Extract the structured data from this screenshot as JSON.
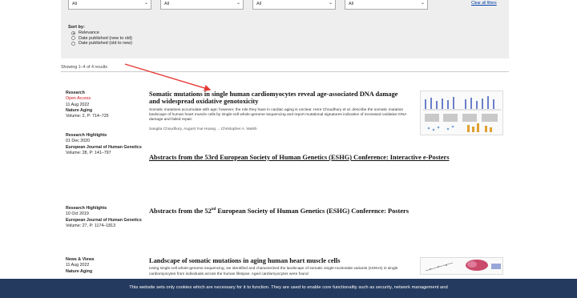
{
  "filters": {
    "selects": [
      "All",
      "All",
      "All",
      "All"
    ],
    "clear_label": "Clear all filters"
  },
  "sort": {
    "title": "Sort by:",
    "options": [
      "Relevance",
      "Date published (new to old)",
      "Date published (old to new)"
    ],
    "selected_index": 0
  },
  "results": {
    "showing": "Showing 1–4 of 4 results"
  },
  "articles": [
    {
      "type": "Research",
      "access": "Open Access",
      "date": "11 Aug 2022",
      "journal": "Nature Aging",
      "volume": "Volume: 2, P: 714–725",
      "title": "Somatic mutations in single human cardiomyocytes reveal age-associated DNA damage and widespread oxidative genotoxicity",
      "abstract": "Somatic mutations accumulate with age; however, the role they have in cardiac aging is unclear. Here Choudhury et al. describe the somatic mutation landscape of human heart muscle cells by single-cell whole-genome sequencing and report mutational signatures indicative of increased oxidative DNA damage and failed repair.",
      "authors": "Sangita Choudhury, August Yue Huang ... Christopher A. Walsh"
    },
    {
      "type": "Research Highlights",
      "date": "01 Dec 2020",
      "journal": "European Journal of Human Genetics",
      "volume": "Volume: 28, P: 141–797",
      "title": "Abstracts from the 53rd European Society of Human Genetics (ESHG) Conference: Interactive e-Posters"
    },
    {
      "type": "Research Highlights",
      "date": "10 Oct 2019",
      "journal": "European Journal of Human Genetics",
      "volume": "Volume: 27, P: 1174–1813",
      "title_pre": "Abstracts from the 52",
      "title_sup": "nd",
      "title_post": " European Society of Human Genetics (ESHG) Conference: Posters"
    },
    {
      "type": "News & Views",
      "date": "11 Aug 2022",
      "journal": "Nature Aging",
      "title": "Landscape of somatic mutations in aging human heart muscle cells",
      "abstract": "Using single-cell whole-genome sequencing, we identified and characterized the landscape of somatic single-nucleotide variants (sSNVs) in single cardiomyocytes from individuals across the human lifespan. Aged cardiomyocytes were found"
    }
  ],
  "cookie": {
    "text": "This website sets only cookies which are necessary for it to function. They are used to enable core functionality such as security, network management and"
  },
  "colors": {
    "open_access": "#d0101a",
    "cookie_bg": "#243a5e",
    "arrow": "#e53935"
  }
}
